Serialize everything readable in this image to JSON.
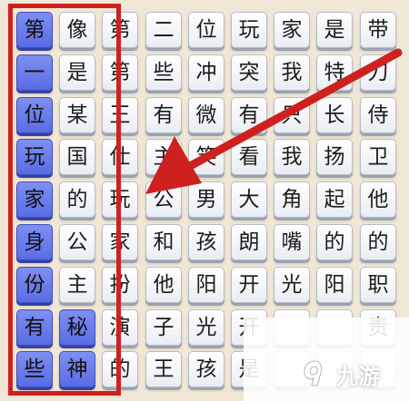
{
  "puzzle": {
    "rows": [
      [
        "第",
        "像",
        "第",
        "二",
        "位",
        "玩",
        "家",
        "是",
        "带"
      ],
      [
        "一",
        "是",
        "第",
        "些",
        "冲",
        "突",
        "我",
        "特",
        "刀"
      ],
      [
        "位",
        "某",
        "王",
        "有",
        "微",
        "有",
        "只",
        "长",
        "侍"
      ],
      [
        "玩",
        "国",
        "仕",
        "主",
        "笑",
        "看",
        "我",
        "扬",
        "卫"
      ],
      [
        "家",
        "的",
        "玩",
        "公",
        "男",
        "大",
        "角",
        "起",
        "他"
      ],
      [
        "身",
        "公",
        "家",
        "和",
        "孩",
        "朗",
        "嘴",
        "的",
        "的"
      ],
      [
        "份",
        "主",
        "扮",
        "他",
        "阳",
        "开",
        "光",
        "阳",
        "职"
      ],
      [
        "有",
        "秘",
        "演",
        "子",
        "光",
        "开",
        "",
        "",
        "责"
      ],
      [
        "些",
        "神",
        "的",
        "王",
        "孩",
        "是",
        "",
        "",
        ""
      ]
    ],
    "selected": [
      [
        0,
        0
      ],
      [
        1,
        0
      ],
      [
        2,
        0
      ],
      [
        3,
        0
      ],
      [
        4,
        0
      ],
      [
        5,
        0
      ],
      [
        6,
        0
      ],
      [
        7,
        0
      ],
      [
        8,
        0
      ],
      [
        7,
        1
      ],
      [
        8,
        1
      ]
    ]
  },
  "colors": {
    "highlight_frame": "#cf2020",
    "arrow": "#cf2020",
    "selected_tile": "#5a6ce4"
  },
  "watermark": {
    "icon": "nine-game-logo-icon",
    "text": "九游"
  }
}
